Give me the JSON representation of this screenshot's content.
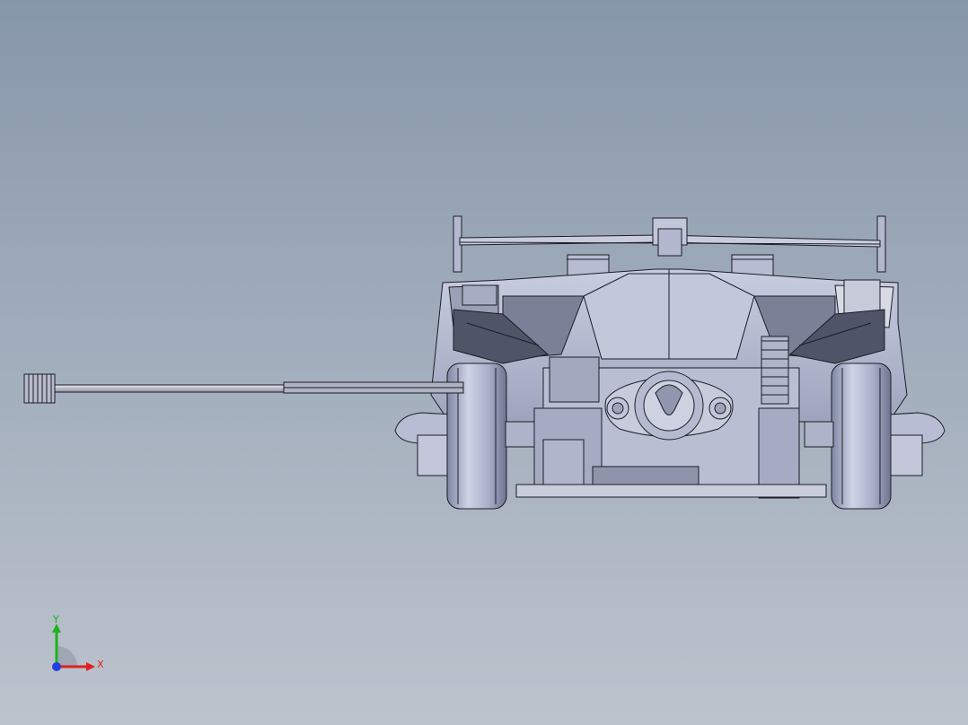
{
  "viewport": {
    "background_top": "#8797aa",
    "background_bottom": "#bcc3cd",
    "model_colors": {
      "body": "#b9bfd6",
      "body_dark": "#8d93aa",
      "body_shadow": "#5e6375",
      "tire": "#aab0cc",
      "tire_highlight": "#d6daea",
      "shaft": "#c9ccd8",
      "edge": "#1b1d25"
    }
  },
  "triad": {
    "x_label": "X",
    "y_label": "Y",
    "x_color": "#e02020",
    "y_color": "#19b519",
    "z_color": "#2040e0"
  }
}
